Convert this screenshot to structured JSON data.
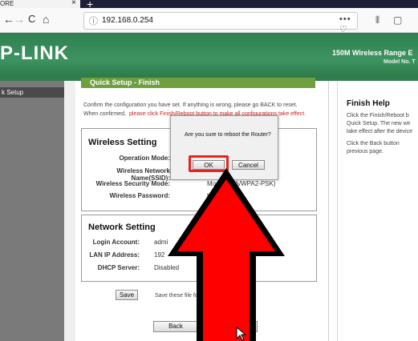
{
  "browser": {
    "tab_title": "ORE",
    "tab_close": "×",
    "new_tab": "+",
    "nav_back": "←",
    "nav_forward": "→",
    "nav_reload": "C",
    "nav_home": "⌂",
    "url_info_icon": "ⓘ",
    "url": "192.168.0.254",
    "url_actions": "••• ♡ ☆",
    "tool_library": "⫴",
    "tool_sidebar": "▢"
  },
  "router": {
    "logo": "P-LINK",
    "model": "150M Wireless Range E",
    "model_no": "Model No. T",
    "nav_item": "k Setup"
  },
  "page": {
    "title": "Quick Setup - Finish",
    "confirm_line1": "Confirm the configuration you have set. If anything is wrong, please go BACK to reset.",
    "confirm_line2a": "When confirmed,",
    "confirm_line2b": "please click Finish/Reboot button to make all configurations take effect.",
    "wireless": {
      "title": "Wireless Setting",
      "rows": [
        {
          "label": "Operation Mode:",
          "value": ""
        },
        {
          "label": "Wireless Network Name(SSID):",
          "value": ""
        },
        {
          "label": "Wireless Security Mode:",
          "value": "Most  (WPA/WPA2-PSK)"
        },
        {
          "label": "Wireless Password:",
          "value": "tes"
        }
      ]
    },
    "network": {
      "title": "Network Setting",
      "rows": [
        {
          "label": "Login Account:",
          "value": "admi"
        },
        {
          "label": "LAN IP Address:",
          "value": "192"
        },
        {
          "label": "DHCP Server:",
          "value": "Disabled"
        }
      ]
    },
    "save_button": "Save",
    "save_note": "Save these  file for future reference",
    "back_button": "Back",
    "reboot_button": "oot"
  },
  "help": {
    "title": "Finish Help",
    "lines1": [
      "Click the Finish/Reboot b",
      "Quick Setup. The new wir",
      "take effect after the device"
    ],
    "lines2": [
      "Click the Back button",
      "previous page."
    ]
  },
  "dialog": {
    "message": "Are you sure to reboot the Router?",
    "ok": "OK",
    "cancel": "Cancel"
  },
  "colors": {
    "header_green": "#3d9460",
    "title_green": "#6f9f3f",
    "highlight_red": "#e8231f",
    "arrow_red": "#ff0000"
  }
}
